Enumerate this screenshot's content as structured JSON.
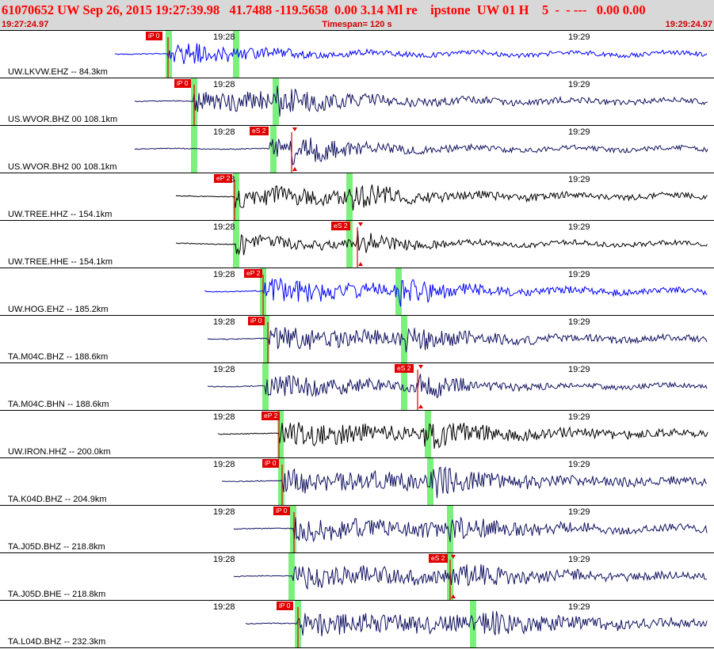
{
  "header": {
    "event_line": "61070652 UW Sep 26, 2015 19:27:39.98   41.7488 -119.5658  0.00 3.14 Ml re    ipstone  UW 01 H    5  -  - ---   0.00 0.00",
    "start_time": "19:27:24.97",
    "timespan": "Timespan= 120 s",
    "end_time": "19:29:24.97"
  },
  "time_ticks": [
    "19:28",
    "19:29"
  ],
  "colors": {
    "header_bg": "#d8d8d8",
    "header_text": "#ff0000",
    "pick_flag": "#e00000",
    "phase_marker": "#7cf07c",
    "trace_blue": "#0000ff",
    "trace_navy": "#101060",
    "trace_black": "#000000"
  },
  "traces": [
    {
      "label": "UW.LKVW.EHZ -- 84.3km",
      "pick": "iP 0",
      "color": "blue"
    },
    {
      "label": "US.WVOR.BHZ 00 108.1km",
      "pick": "iP 0",
      "color": "navy"
    },
    {
      "label": "US.WVOR.BH2 00 108.1km",
      "pick": "eS 2",
      "color": "navy"
    },
    {
      "label": "UW.TREE.HHZ -- 154.1km",
      "pick": "eP 2",
      "color": "black"
    },
    {
      "label": "UW.TREE.HHE -- 154.1km",
      "pick": "eS 2",
      "color": "black"
    },
    {
      "label": "UW.HOG.EHZ -- 185.2km",
      "pick": "eP 2",
      "color": "blue"
    },
    {
      "label": "TA.M04C.BHZ -- 188.6km",
      "pick": "iP 0",
      "color": "navy"
    },
    {
      "label": "TA.M04C.BHN -- 188.6km",
      "pick": "eS 2",
      "color": "navy"
    },
    {
      "label": "UW.IRON.HHZ -- 200.0km",
      "pick": "eP 2",
      "color": "black"
    },
    {
      "label": "TA.K04D.BHZ -- 204.9km",
      "pick": "iP 0",
      "color": "navy"
    },
    {
      "label": "TA.J05D.BHZ -- 218.8km",
      "pick": "iP 0",
      "color": "navy"
    },
    {
      "label": "TA.J05D.BHE -- 218.8km",
      "pick": "eS 2",
      "color": "navy"
    },
    {
      "label": "TA.L04D.BHZ -- 232.3km",
      "pick": "iP 0",
      "color": "navy"
    }
  ]
}
